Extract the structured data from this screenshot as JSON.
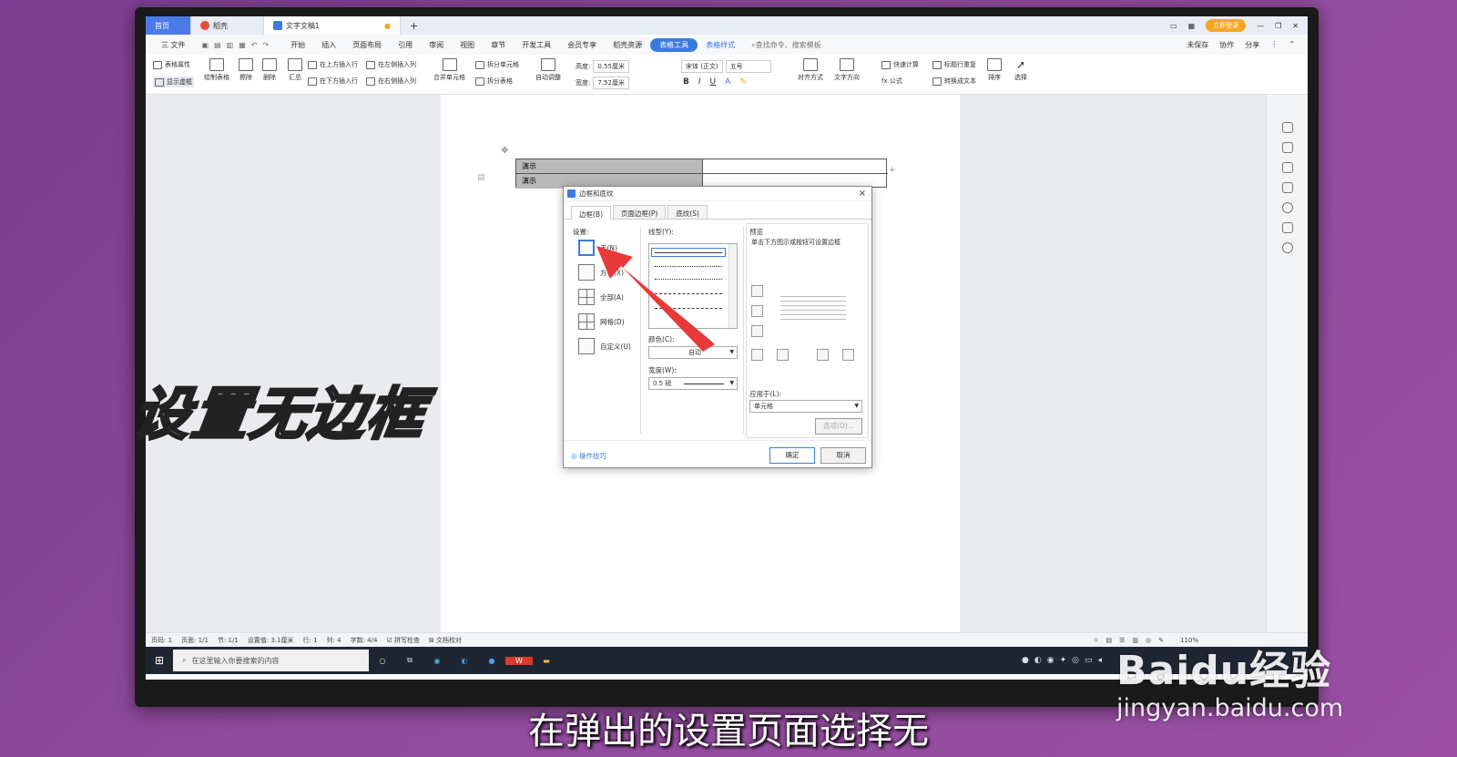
{
  "titlebar": {
    "home_tab": "首页",
    "tab2": "稻壳",
    "doc_tab": "文字文稿1",
    "new_tab": "+",
    "login": "立即登录"
  },
  "menubar": {
    "items": [
      "三 文件",
      "开始",
      "插入",
      "页面布局",
      "引用",
      "审阅",
      "视图",
      "章节",
      "开发工具",
      "会员专享",
      "稻壳资源"
    ],
    "active": "表格工具",
    "style": "表格样式",
    "search": "查找命令、搜索模板",
    "unsaved": "未保存",
    "collab": "协作",
    "share": "分享"
  },
  "ribbon": {
    "table_props": "表格属性",
    "show_grid": "显示虚框",
    "draw_table": "绘制表格",
    "erase": "擦除",
    "delete": "删除",
    "summary": "汇总",
    "insert_above": "在上方插入行",
    "insert_below": "在下方插入行",
    "insert_left": "在左侧插入列",
    "insert_right": "在右侧插入列",
    "merge": "合并单元格",
    "split_cell": "拆分单元格",
    "split_table": "拆分表格",
    "autofit": "自动调整",
    "height_label": "高度:",
    "height_val": "0.55厘米",
    "width_label": "宽度:",
    "width_val": "7.52厘米",
    "font": "宋体 (正文)",
    "size": "五号",
    "align": "对齐方式",
    "text_dir": "文字方向",
    "quick_calc": "快速计算",
    "title_repeat": "标题行重复",
    "formula": "fx 公式",
    "to_text": "转换成文本",
    "sort": "排序",
    "select": "选择"
  },
  "table": {
    "row1": "演示",
    "row2": "演示"
  },
  "dialog": {
    "title": "边框和底纹",
    "close": "×",
    "tabs": [
      "边框(B)",
      "页面边框(P)",
      "底纹(S)"
    ],
    "setting_label": "设置:",
    "settings": [
      "无(N)",
      "方框(X)",
      "全部(A)",
      "网格(D)",
      "自定义(U)"
    ],
    "linetype_label": "线型(Y):",
    "color_label": "颜色(C):",
    "color_val": "自动",
    "width_label": "宽度(W):",
    "width_val": "0.5   磅",
    "preview_label": "预览",
    "preview_hint": "单击下方图示或按钮可设置边框",
    "apply_label": "应用于(L):",
    "apply_val": "单元格",
    "options_btn": "选项(O)...",
    "tips": "操作技巧",
    "ok": "确定",
    "cancel": "取消"
  },
  "statusbar": {
    "page_num": "页码: 1",
    "pages": "页面: 1/1",
    "section": "节: 1/1",
    "setting": "设置值: 3.1厘米",
    "row": "行: 1",
    "col": "列: 4",
    "words": "字数: 4/4",
    "spell": "拼写检查",
    "proof": "文档校对",
    "zoom": "110%"
  },
  "taskbar": {
    "search_placeholder": "在这里输入你要搜索的内容"
  },
  "overlay": {
    "left_caption": "设置无边框",
    "subtitle": "在弹出的设置页面选择无",
    "watermark_logo": "Baidu经验",
    "watermark_url": "jingyan.baidu.com"
  },
  "colors": {
    "accent": "#3a7be0",
    "arrow": "#e83a3a",
    "background": "#8f4a9c"
  }
}
